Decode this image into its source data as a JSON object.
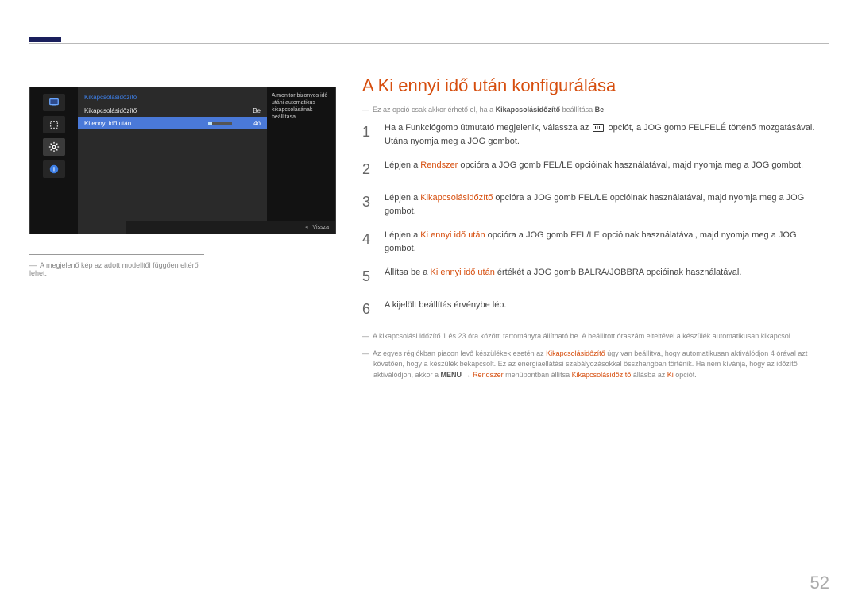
{
  "page_number": "52",
  "title": "A Ki ennyi idő után konfigurálása",
  "osd": {
    "header": "Kikapcsolásidőzítő",
    "rows": [
      {
        "label": "Kikapcsolásidőzítő",
        "value": "Be"
      },
      {
        "label": "Ki ennyi idő után",
        "value": "4ó",
        "slider_pct": 17
      }
    ],
    "description": "A monitor bizonyos idő utáni automatikus kikapcsolásának beállítása.",
    "footer_back": "Vissza"
  },
  "osd_note": "A megjelenő kép az adott modelltől függően eltérő lehet.",
  "pre_note": {
    "prefix": "Ez az opció csak akkor érhető el, ha a ",
    "bold1": "Kikapcsolásidőzítő",
    "mid": " beállítása ",
    "bold2": "Be"
  },
  "steps": [
    {
      "num": "1",
      "parts": [
        {
          "t": "plain",
          "v": "Ha a Funkciógomb útmutató megjelenik, válassza az "
        },
        {
          "t": "icon"
        },
        {
          "t": "plain",
          "v": " opciót, a JOG gomb FELFELÉ történő mozgatásával. Utána nyomja meg a JOG gombot."
        }
      ]
    },
    {
      "num": "2",
      "parts": [
        {
          "t": "plain",
          "v": "Lépjen a "
        },
        {
          "t": "bold",
          "v": "Rendszer"
        },
        {
          "t": "plain",
          "v": " opcióra a JOG gomb FEL/LE opcióinak használatával, majd nyomja meg a JOG gombot."
        }
      ]
    },
    {
      "num": "3",
      "parts": [
        {
          "t": "plain",
          "v": "Lépjen a "
        },
        {
          "t": "bold",
          "v": "Kikapcsolásidőzítő"
        },
        {
          "t": "plain",
          "v": " opcióra a JOG gomb FEL/LE opcióinak használatával, majd nyomja meg a JOG gombot."
        }
      ]
    },
    {
      "num": "4",
      "parts": [
        {
          "t": "plain",
          "v": "Lépjen a "
        },
        {
          "t": "bold",
          "v": "Ki ennyi idő után"
        },
        {
          "t": "plain",
          "v": " opcióra a JOG gomb FEL/LE opcióinak használatával, majd nyomja meg a JOG gombot."
        }
      ]
    },
    {
      "num": "5",
      "parts": [
        {
          "t": "plain",
          "v": "Állítsa be a "
        },
        {
          "t": "bold",
          "v": "Ki ennyi idő után"
        },
        {
          "t": "plain",
          "v": " értékét a JOG gomb BALRA/JOBBRA opcióinak használatával."
        }
      ]
    },
    {
      "num": "6",
      "parts": [
        {
          "t": "plain",
          "v": "A kijelölt beállítás érvénybe lép."
        }
      ]
    }
  ],
  "post_notes": [
    {
      "parts": [
        {
          "t": "plain",
          "v": "A kikapcsolási időzítő 1 és 23 óra közötti tartományra állítható be. A beállított óraszám elteltével a készülék automatikusan kikapcsol."
        }
      ]
    },
    {
      "parts": [
        {
          "t": "plain",
          "v": "Az egyes régiókban piacon levő készülékek esetén az "
        },
        {
          "t": "bold",
          "v": "Kikapcsolásidőzítő"
        },
        {
          "t": "plain",
          "v": " úgy van beállítva, hogy automatikusan aktiválódjon 4 órával azt követően, hogy a készülék bekapcsolt. Ez az energiaellátási szabályozásokkal összhangban történik. Ha nem kívánja, hogy az időzítő aktiválódjon, akkor a "
        },
        {
          "t": "strong",
          "v": "MENU"
        },
        {
          "t": "plain",
          "v": " → "
        },
        {
          "t": "bold",
          "v": "Rendszer"
        },
        {
          "t": "plain",
          "v": " menüpontban állítsa "
        },
        {
          "t": "bold",
          "v": "Kikapcsolásidőzítő"
        },
        {
          "t": "plain",
          "v": " állásba az "
        },
        {
          "t": "bold",
          "v": "Ki"
        },
        {
          "t": "plain",
          "v": " opciót."
        }
      ]
    }
  ]
}
